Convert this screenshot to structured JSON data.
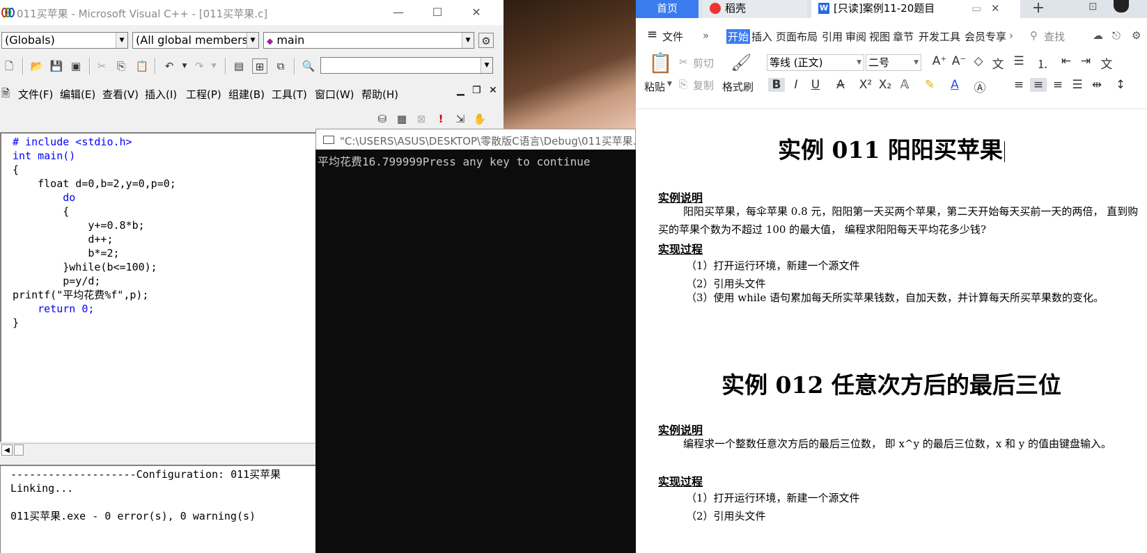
{
  "vc": {
    "title": "011买苹果 - Microsoft Visual C++ - [011买苹果.c]",
    "window_buttons": {
      "minimize": "—",
      "maximize": "☐",
      "close": "✕"
    },
    "scope_combo": "(Globals)",
    "members_combo": "(All global members",
    "function_combo": "main",
    "menu": [
      "文件(F)",
      "编辑(E)",
      "查看(V)",
      "插入(I)",
      "工程(P)",
      "组建(B)",
      "工具(T)",
      "窗口(W)",
      "帮助(H)"
    ],
    "code_lines": [
      "# include <stdio.h>",
      "int main()",
      "{",
      "    float d=0,b=2,y=0,p=0;",
      "        do",
      "        {",
      "            y+=0.8*b;",
      "            d++;",
      "            b*=2;",
      "        }while(b<=100);",
      "        p=y/d;",
      "printf(\"平均花费%f\",p);",
      "    return 0;",
      "}"
    ],
    "output_lines": [
      "--------------------Configuration: 011买苹果",
      "Linking...",
      "",
      "011买苹果.exe - 0 error(s), 0 warning(s)"
    ]
  },
  "console": {
    "title": "\"C:\\USERS\\ASUS\\DESKTOP\\零散版C语言\\Debug\\011买苹果.",
    "text": "平均花费16.799999Press any key to continue"
  },
  "wps": {
    "tabs": {
      "home": "首页",
      "daoke": "稻壳",
      "doc": "[只读]案例11-20题目",
      "new": "+"
    },
    "menu_file": "文件",
    "ribbon_tabs": [
      "开始",
      "插入",
      "页面布局",
      "引用",
      "审阅",
      "视图",
      "章节",
      "开发工具",
      "会员专享"
    ],
    "search": "查找",
    "paste": "粘贴",
    "cut": "剪切",
    "copy": "复制",
    "format_painter": "格式刷",
    "font_name": "等线 (正文)",
    "font_size": "二号",
    "doc": {
      "title1": "实例 011 阳阳买苹果",
      "sec_desc": "实例说明",
      "desc1": "阳阳买苹果，每伞苹果 0.8 元，阳阳第一天买两个苹果，第二天开始每天买前一天的两倍， 直到购买的苹果个数为不超过 100 的最大值， 编程求阳阳每天平均花多少钱?",
      "sec_impl": "实现过程",
      "steps1": [
        "（1）打开运行环境，新建一个源文件",
        "（2）引用头文件",
        "（3）使用 while 语句累加每夭所实苹果钱数，自加天数，并计算每天所买苹果数的变化。"
      ],
      "title2": "实例 012 任意次方后的最后三位",
      "desc2": "编程求一个整数任意次方后的最后三位数， 即 x^y 的最后三位数，x 和 y 的值由键盘输入。",
      "steps2": [
        "（1）打开运行环境，新建一个源文件",
        "（2）引用头文件"
      ]
    }
  }
}
